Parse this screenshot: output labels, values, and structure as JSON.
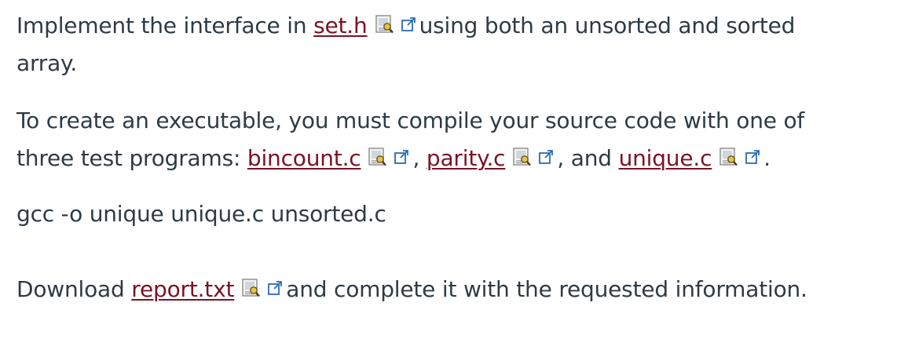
{
  "paragraphs": {
    "p1": {
      "before": "Implement the interface in ",
      "link": "set.h",
      "after": "using both an unsorted and sorted array."
    },
    "p2": {
      "before": "To create an executable, you must compile your source code with one of three test programs: ",
      "link1": "bincount.c",
      "sep1": ", ",
      "link2": "parity.c",
      "sep2": ", and ",
      "link3": "unique.c",
      "end": "."
    },
    "p3": {
      "text": "gcc -o unique unique.c unsorted.c"
    },
    "p4": {
      "before": "Download ",
      "link": "report.txt",
      "after": "and complete it with the requested information."
    }
  },
  "icons": {
    "preview": "document-preview-icon",
    "external": "external-link-icon"
  },
  "colors": {
    "text": "#2d3b45",
    "link": "#7a1324",
    "external_icon": "#2b6cb0"
  }
}
